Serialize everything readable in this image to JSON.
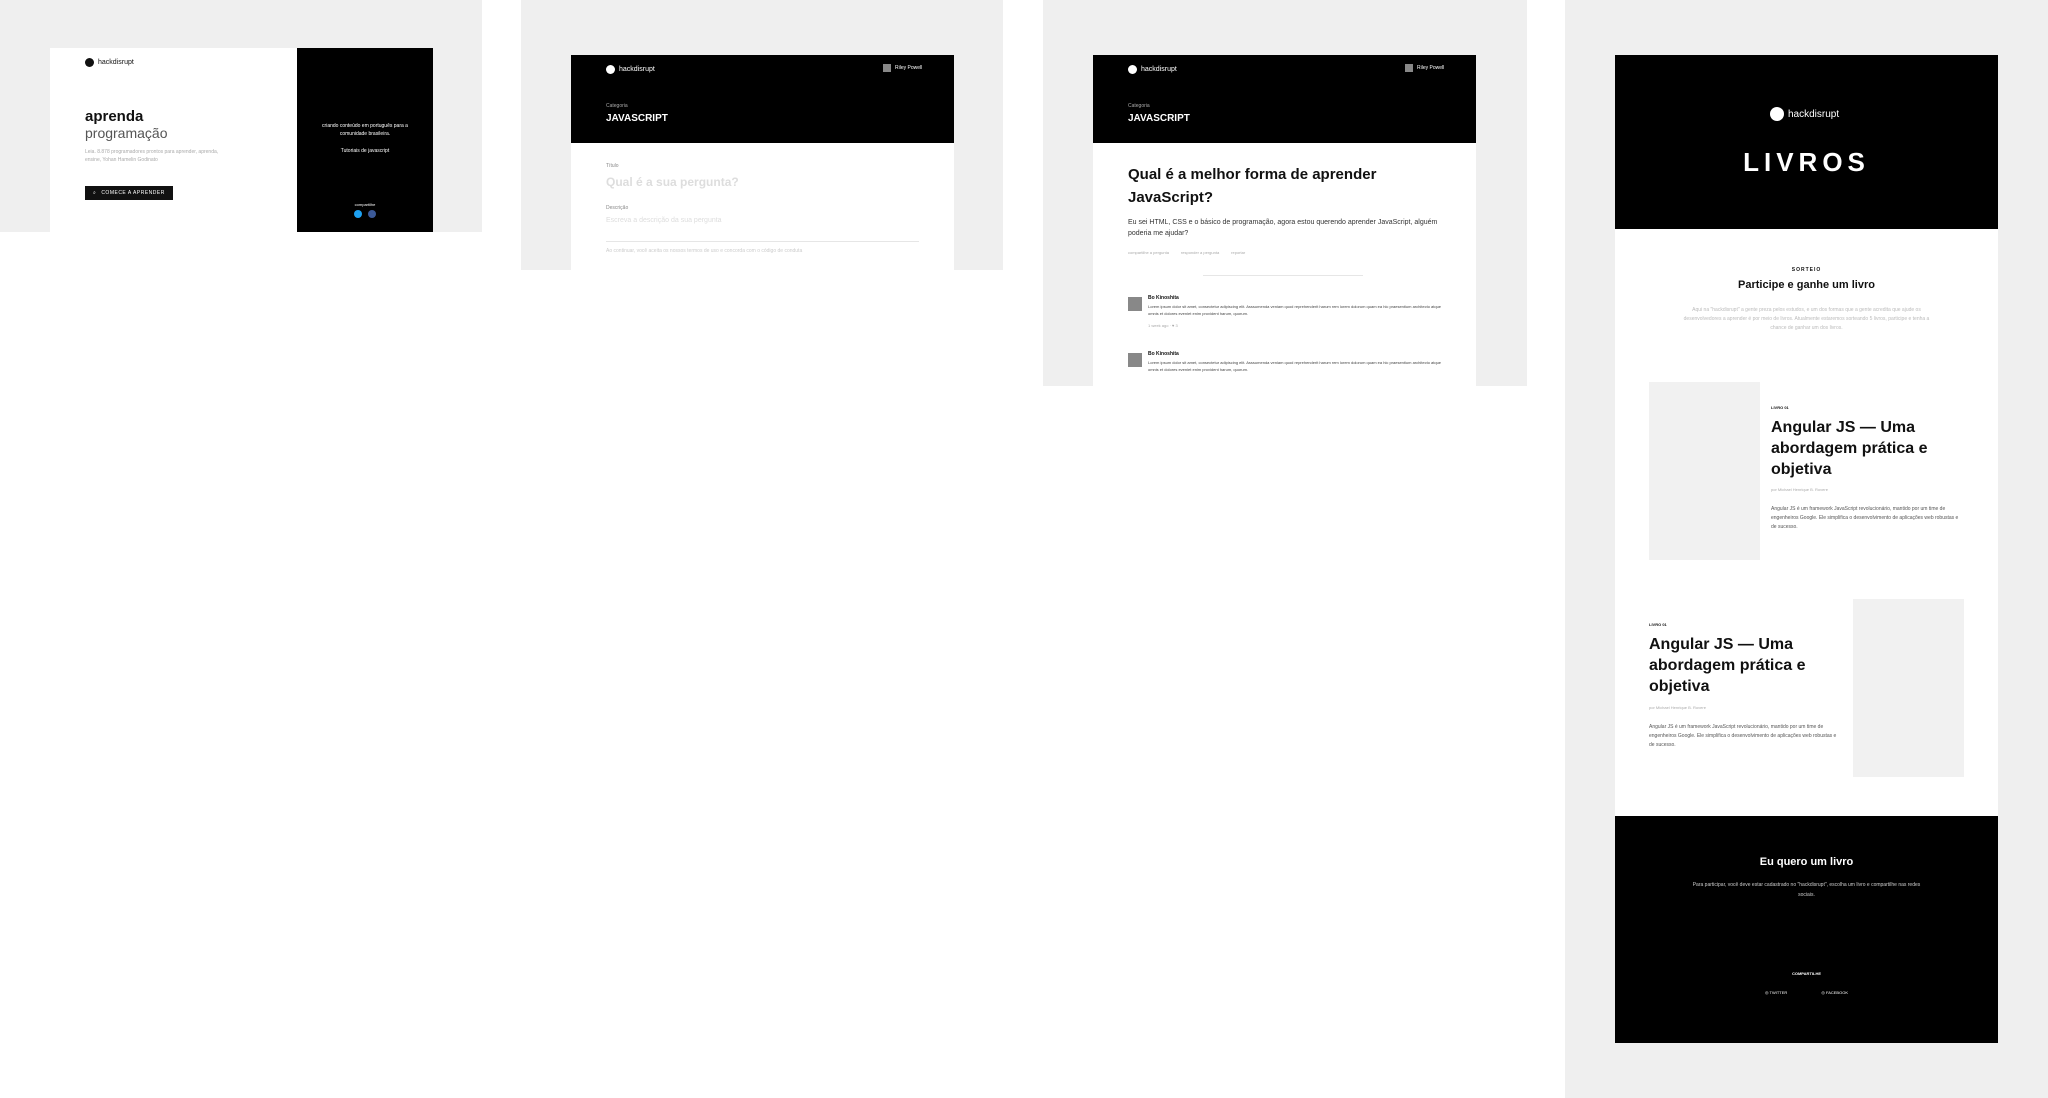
{
  "panel1": {
    "logo_text": "hackdisrupt",
    "headline_bold": "aprenda",
    "headline_light": "programação",
    "subtext": "Leia. 8.878 programadores prontos para aprender, aprenda, ensine, Yohan Hamelin Godinato",
    "cta_label": "COMECE A APRENDER",
    "right_text": "criando conteúdo em português para a comunidade brasileira.",
    "right_sub": "Tutoriais de javascript",
    "share_label": "compartilhe"
  },
  "panel2": {
    "logo_text": "hackdisrupt",
    "user_name": "Riley Powell",
    "category_label": "Categoria",
    "category_value": "JAVASCRIPT",
    "title_label": "Título",
    "title_placeholder": "Qual é a sua pergunta?",
    "desc_label": "Descrição",
    "desc_placeholder": "Escreva a descrição da sua pergunta",
    "footer_note": "Ao continuar, você aceita os nossos termos de uso e concorda com o código de conduta"
  },
  "panel3": {
    "logo_text": "hackdisrupt",
    "user_name": "Riley Powell",
    "category_label": "Categoria",
    "category_value": "JAVASCRIPT",
    "question_title": "Qual é a melhor forma de aprender JavaScript?",
    "question_body": "Eu sei HTML, CSS e o básico de programação, agora estou querendo aprender JavaScript, alguém poderia me ajudar?",
    "meta": [
      "compartilhe a pergunta",
      "responder a pergunta",
      "reportar"
    ],
    "answers": [
      {
        "author": "Bo Kinoshita",
        "text": "Lorem ipsum dolor sit amet, consectetur adipiscing elit. Asssumenda veniam quod reprehenderit harum rem lorem dolorum quam ea hic praesentium architecto atque omnis et dolores eveniet enim provident harum, quorum.",
        "meta": "1 week ago · ♥ 3"
      },
      {
        "author": "Bo Kinoshita",
        "text": "Lorem ipsum dolor sit amet, consectetur adipiscing elit. Asssumenda veniam quod reprehenderit harum rem lorem dolorum quam ea hic praesentium architecto atque omnis et dolores eveniet enim provident harum, quorum.",
        "meta": ""
      }
    ]
  },
  "panel4": {
    "logo_text": "hackdisrupt",
    "hero_title": "LIVROS",
    "sorteio_label": "SORTEIO",
    "sorteio_title": "Participe e ganhe um livro",
    "sorteio_text": "Aqui na \"hackdisrupt\" a gente preza pelos estudos, e um dos formas que a gente acredita que ajude os desenvolvedores a aprender é por meio de livros. Atualmente estaremos sorteando 5 livros, participe e tenha a chance de ganhar um dos livros.",
    "books": [
      {
        "tag": "LIVRO 01",
        "title": "Angular JS — Uma abordagem prática e objetiva",
        "author": "por Michael Henrique B. Rovere",
        "desc": "Angular JS é um framework JavaScript revolucionário, mantido por um time de engenheiros Google. Ele simplifica o desenvolvimento de aplicações web robustas e de sucesso."
      },
      {
        "tag": "LIVRO 01",
        "title": "Angular JS — Uma abordagem prática e objetiva",
        "author": "por Michael Henrique B. Rovere",
        "desc": "Angular JS é um framework JavaScript revolucionário, mantido por um time de engenheiros Google. Ele simplifica o desenvolvimento de aplicações web robustas e de sucesso."
      }
    ],
    "footer_title": "Eu quero um livro",
    "footer_text": "Para participar, você deve estar cadastrado no \"hackdisrupt\", escolha um livro e compartilhe nas redes sociais.",
    "share_label": "COMPARTILHE",
    "twitter_label": "TWITTER",
    "facebook_label": "FACEBOOK"
  },
  "colors": {
    "black": "#000000",
    "gray_bg": "#efefef",
    "twitter": "#1da1f2",
    "facebook": "#3b5998"
  }
}
